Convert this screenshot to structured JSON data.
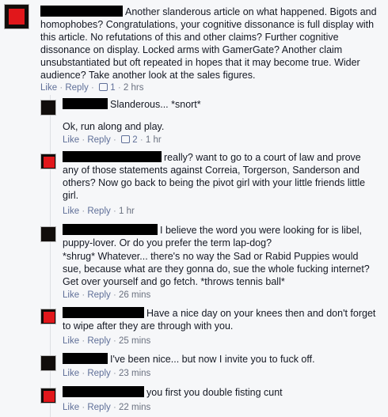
{
  "comments": [
    {
      "text": "Another slanderous article on what happened. Bigots and homophobes? Congratulations, your cognitive dissonance is full display with this article. No refutations of this and other claims? Further cognitive dissonance on display. Locked arms with GamerGate? Another claim unsubstantiated but oft repeated in hopes that it may become true. Wider audience? Take another look at the sales figures.",
      "like": "Like",
      "reply": "Reply",
      "likes": "1",
      "time": "2 hrs"
    },
    {
      "text": "Slanderous... *snort*",
      "text2": "Ok, run along and play.",
      "like": "Like",
      "reply": "Reply",
      "likes": "2",
      "time": "1 hr"
    },
    {
      "text": "really? want to go to a court of law and prove any of those statements against Correia, Torgerson, Sanderson and others? Now go back to being the pivot girl with your little friends little girl.",
      "like": "Like",
      "reply": "Reply",
      "time": "1 hr"
    },
    {
      "text": "I believe the word you were looking for is libel, puppy-lover. Or do you prefer the term lap-dog?",
      "text2": "*shrug* Whatever... there's no way the Sad or Rabid Puppies would sue, because what are they gonna do, sue the whole fucking internet? Get over yourself and go fetch. *throws tennis ball*",
      "like": "Like",
      "reply": "Reply",
      "time": "26 mins"
    },
    {
      "text": "Have a nice day on your knees then and don't forget to wipe after they are through with you.",
      "like": "Like",
      "reply": "Reply",
      "time": "25 mins"
    },
    {
      "text": "I've been nice... but now I invite you to fuck off.",
      "like": "Like",
      "reply": "Reply",
      "time": "23 mins"
    },
    {
      "text": "you first you double fisting cunt",
      "like": "Like",
      "reply": "Reply",
      "time": "22 mins"
    }
  ]
}
